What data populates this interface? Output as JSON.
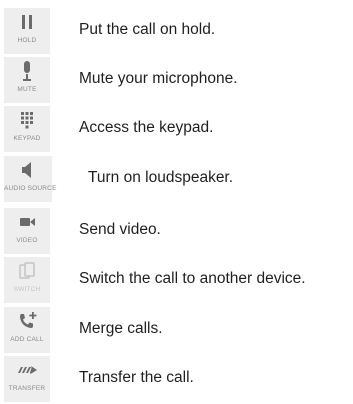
{
  "rows": [
    {
      "icon": "pause-icon",
      "caption": "HOLD",
      "text": "Put the call on hold."
    },
    {
      "icon": "microphone-icon",
      "caption": "MUTE",
      "text": "Mute your microphone."
    },
    {
      "icon": "keypad-icon",
      "caption": "KEYPAD",
      "text": "Access the keypad."
    },
    {
      "icon": "speaker-icon",
      "caption": "AUDIO SOURCE",
      "text": "Turn on loudspeaker."
    },
    {
      "icon": "video-camera-icon",
      "caption": "VIDEO",
      "text": "Send video."
    },
    {
      "icon": "switch-device-icon",
      "caption": "SWITCH",
      "text": "Switch the call to another device."
    },
    {
      "icon": "add-call-icon",
      "caption": "ADD CALL",
      "text": "Merge calls."
    },
    {
      "icon": "transfer-icon",
      "caption": "TRANSFER",
      "text": "Transfer the call."
    }
  ],
  "colors": {
    "icon": "#6b6b6b",
    "icon_disabled": "#c4c4c4",
    "tile": "#eeeeee",
    "caption": "#8a8a8a",
    "text": "#1f1f1f"
  }
}
